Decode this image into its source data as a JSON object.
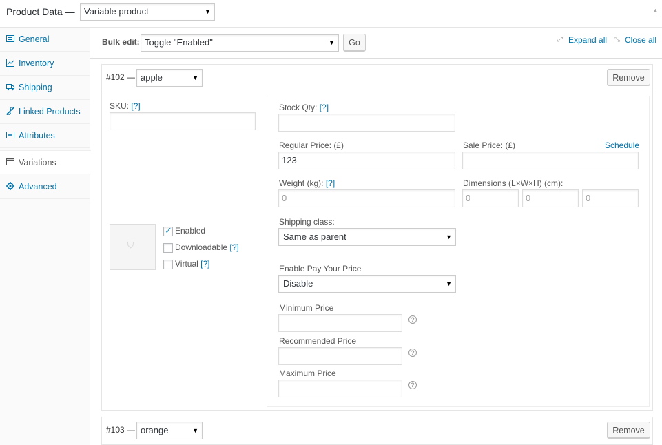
{
  "header": {
    "title": "Product Data —",
    "product_type": "Variable product"
  },
  "sidebar": {
    "items": [
      {
        "label": "General",
        "icon": "general-icon"
      },
      {
        "label": "Inventory",
        "icon": "inventory-icon"
      },
      {
        "label": "Shipping",
        "icon": "shipping-icon"
      },
      {
        "label": "Linked Products",
        "icon": "link-icon"
      },
      {
        "label": "Attributes",
        "icon": "attributes-icon"
      },
      {
        "label": "Variations",
        "icon": "variations-icon"
      },
      {
        "label": "Advanced",
        "icon": "gear-icon"
      }
    ],
    "active_index": 5
  },
  "toolbar": {
    "bulk_label": "Bulk edit:",
    "bulk_value": "Toggle \"Enabled\"",
    "go_label": "Go",
    "expand_all": "Expand all",
    "close_all": "Close all"
  },
  "variation1": {
    "id": "#102 —",
    "attribute": "apple",
    "remove": "Remove",
    "sku_label": "SKU:",
    "help_mark": "[?]",
    "sku_value": "",
    "enabled_label": "Enabled",
    "enabled_checked": true,
    "downloadable_label": "Downloadable",
    "downloadable_checked": false,
    "virtual_label": "Virtual",
    "virtual_checked": false,
    "stock_label": "Stock Qty:",
    "stock_value": "",
    "regular_label": "Regular Price: (£)",
    "regular_value": "123",
    "sale_label": "Sale Price: (£)",
    "schedule": "Schedule",
    "sale_value": "",
    "weight_label": "Weight (kg):",
    "weight_placeholder": "0",
    "dimensions_label": "Dimensions (L×W×H) (cm):",
    "dim_placeholder": "0",
    "shipping_label": "Shipping class:",
    "shipping_value": "Same as parent",
    "pyp_label": "Enable Pay Your Price",
    "pyp_value": "Disable",
    "min_label": "Minimum Price",
    "rec_label": "Recommended Price",
    "max_label": "Maximum Price",
    "help_q": "?"
  },
  "variation2": {
    "id": "#103 —",
    "attribute": "orange",
    "remove": "Remove"
  },
  "colors": {
    "link": "#0073aa",
    "checkbox_tick": "#1e8cbe"
  }
}
